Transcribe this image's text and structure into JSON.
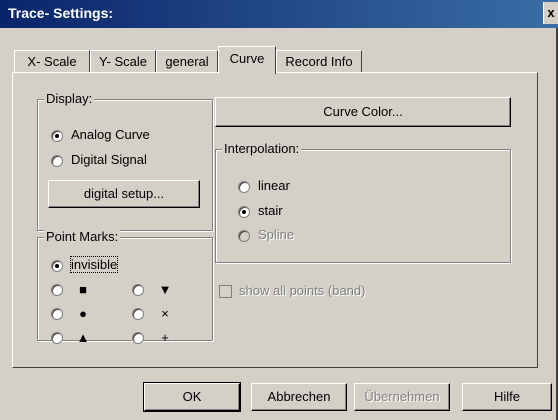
{
  "window": {
    "title": "Trace- Settings:",
    "close_label": "x"
  },
  "tabs": [
    {
      "label": "X- Scale",
      "active": false
    },
    {
      "label": "Y- Scale",
      "active": false
    },
    {
      "label": "general",
      "active": false
    },
    {
      "label": "Curve",
      "active": true
    },
    {
      "label": "Record Info",
      "active": false
    }
  ],
  "display": {
    "legend": "Display:",
    "analog_label": "Analog Curve",
    "digital_label": "Digital Signal",
    "selected": "analog",
    "setup_button": "digital setup..."
  },
  "curve_color_button": "Curve Color...",
  "interpolation": {
    "legend": "Interpolation:",
    "options": [
      "linear",
      "stair",
      "Spline"
    ],
    "selected": "stair",
    "disabled": [
      "Spline"
    ]
  },
  "point_marks": {
    "legend": "Point Marks:",
    "invisible_label": "invisible",
    "selected": "invisible",
    "symbols": [
      "■",
      "▼",
      "●",
      "×",
      "▲",
      "+"
    ],
    "symbol_icons": [
      "square-icon",
      "triangle-down-icon",
      "circle-icon",
      "cross-icon",
      "triangle-up-icon",
      "plus-icon"
    ]
  },
  "show_all_points": {
    "label": "show all points (band)",
    "checked": false,
    "enabled": false
  },
  "buttons": {
    "ok": "OK",
    "cancel": "Abbrechen",
    "apply": "Übernehmen",
    "help": "Hilfe"
  },
  "colors": {
    "titlebar_start": "#0a246a",
    "titlebar_end": "#3a6ea5",
    "face": "#d4d0c8"
  }
}
